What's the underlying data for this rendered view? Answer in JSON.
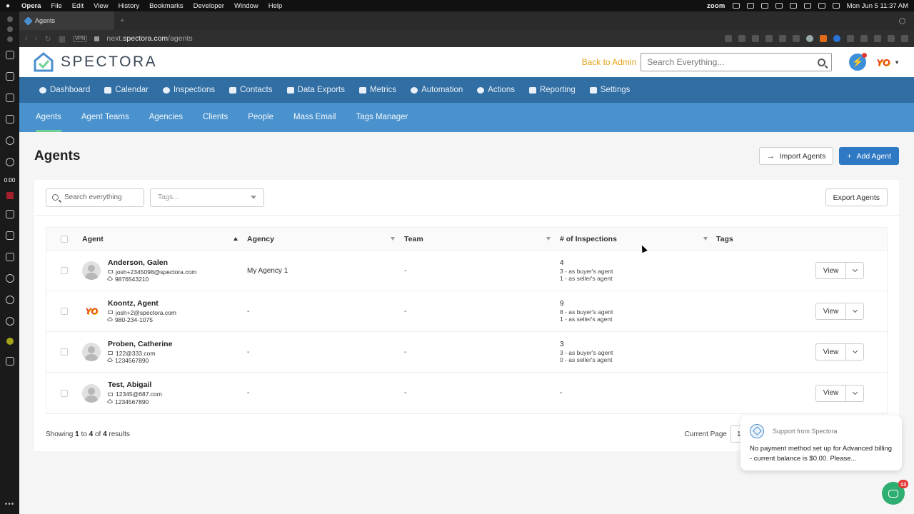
{
  "mac_menu": {
    "app": "Opera",
    "items": [
      "File",
      "Edit",
      "View",
      "History",
      "Bookmarks",
      "Developer",
      "Window",
      "Help"
    ],
    "zoom": "zoom",
    "clock": "Mon Jun 5  11:37 AM"
  },
  "opera_sidebar": {
    "timer": "0:00"
  },
  "browser": {
    "tab_title": "Agents",
    "url_prefix": "next.",
    "url_host": "spectora.com",
    "url_path": "/agents",
    "vpn_label": "VPN"
  },
  "header": {
    "logo_text": "SPECTORA",
    "back_link": "Back to Admin",
    "search_placeholder": "Search Everything...",
    "avatar_text": "YO"
  },
  "primary_nav": [
    {
      "label": "Dashboard",
      "icon": "dashboard-icon"
    },
    {
      "label": "Calendar",
      "icon": "calendar-icon"
    },
    {
      "label": "Inspections",
      "icon": "search-icon"
    },
    {
      "label": "Contacts",
      "icon": "contacts-icon"
    },
    {
      "label": "Data Exports",
      "icon": "table-icon"
    },
    {
      "label": "Metrics",
      "icon": "chart-icon"
    },
    {
      "label": "Automation",
      "icon": "cogs-icon"
    },
    {
      "label": "Actions",
      "icon": "cogs-icon"
    },
    {
      "label": "Reporting",
      "icon": "file-icon"
    },
    {
      "label": "Settings",
      "icon": "menu-icon"
    }
  ],
  "secondary_nav": [
    {
      "label": "Agents",
      "active": true
    },
    {
      "label": "Agent Teams"
    },
    {
      "label": "Agencies"
    },
    {
      "label": "Clients"
    },
    {
      "label": "People"
    },
    {
      "label": "Mass Email"
    },
    {
      "label": "Tags Manager"
    }
  ],
  "page": {
    "title": "Agents",
    "import_label": "Import Agents",
    "add_label": "Add Agent",
    "export_label": "Export Agents"
  },
  "filters": {
    "search_placeholder": "Search everything",
    "tags_placeholder": "Tags..."
  },
  "table": {
    "columns": [
      "Agent",
      "Agency",
      "Team",
      "# of Inspections",
      "Tags"
    ],
    "rows": [
      {
        "name": "Anderson, Galen",
        "email": "josh+2345098@spectora.com",
        "phone": "9876543210",
        "agency": "My Agency 1",
        "team": "-",
        "inspections": "4",
        "buyer": "3 - as buyer's agent",
        "seller": "1 - as seller's agent",
        "avatar": "default"
      },
      {
        "name": "Koontz, Agent",
        "email": "josh+2@spectora.com",
        "phone": "980-234-1075",
        "agency": "-",
        "team": "-",
        "inspections": "9",
        "buyer": "8 - as buyer's agent",
        "seller": "1 - as seller's agent",
        "avatar": "YO"
      },
      {
        "name": "Proben, Catherine",
        "email": "122@333.com",
        "phone": "1234567890",
        "agency": "-",
        "team": "-",
        "inspections": "3",
        "buyer": "3 - as buyer's agent",
        "seller": "0 - as seller's agent",
        "avatar": "default"
      },
      {
        "name": "Test, Abigail",
        "email": "12345@687.com",
        "phone": "1234567890",
        "agency": "-",
        "team": "-",
        "inspections": "-",
        "buyer": "",
        "seller": "",
        "avatar": "default"
      }
    ],
    "view_label": "View"
  },
  "footer": {
    "showing_prefix": "Showing ",
    "from": "1",
    "to_word": " to ",
    "to": "4",
    "of_word": " of ",
    "total": "4",
    "results_word": " results",
    "current_page_label": "Current Page",
    "current_page": "1"
  },
  "toast": {
    "from": "Support from Spectora",
    "message": "No payment method set up for Advanced billing - current balance is $0.00. Please..."
  },
  "chat": {
    "badge": "13"
  },
  "colors": {
    "primary_nav": "#306ea4",
    "secondary_nav": "#4a92cd",
    "accent_gold": "#e3a11a",
    "button_blue": "#2f78c4",
    "chat_green": "#2fae72"
  }
}
